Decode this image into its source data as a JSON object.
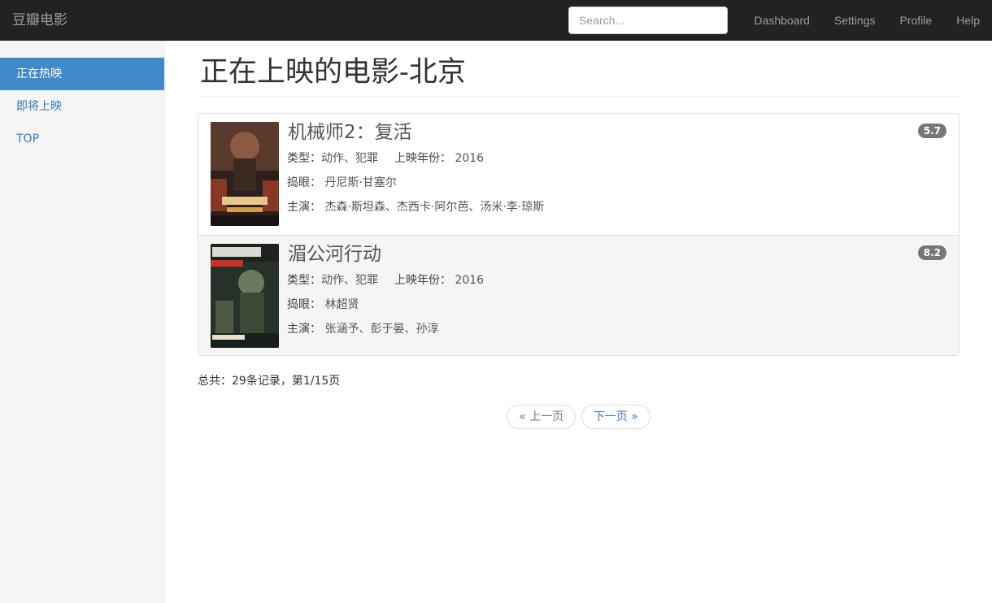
{
  "navbar": {
    "brand": "豆瓣电影",
    "search_placeholder": "Search...",
    "links": [
      "Dashboard",
      "Settings",
      "Profile",
      "Help"
    ]
  },
  "sidebar": {
    "items": [
      {
        "label": "正在热映",
        "active": true
      },
      {
        "label": "即将上映",
        "active": false
      },
      {
        "label": "TOP",
        "active": false
      }
    ]
  },
  "main": {
    "title": "正在上映的电影-北京",
    "labels": {
      "genre": "类型：",
      "year": "上映年份：",
      "director": "捣眼：",
      "cast": "主演："
    },
    "movies": [
      {
        "title": "机械师2：复活",
        "genres": "动作、犯罪",
        "year": "2016",
        "director": "丹尼斯·甘塞尔",
        "cast": "杰森·斯坦森、杰西卡·阿尔芭、汤米·李·琼斯",
        "rating": "5.7",
        "poster_colors": [
          "#3a2a22",
          "#b0412a",
          "#e8c88a"
        ]
      },
      {
        "title": "湄公河行动",
        "genres": "动作、犯罪",
        "year": "2016",
        "director": "林超贤",
        "cast": "张涵予、彭于晏、孙淳",
        "rating": "8.2",
        "poster_colors": [
          "#27312a",
          "#6b7a5c",
          "#c8302a"
        ]
      }
    ],
    "total": "总共：29条记录，第1/15页",
    "pager": {
      "prev": "« 上一页",
      "next": "下一页 »"
    }
  }
}
